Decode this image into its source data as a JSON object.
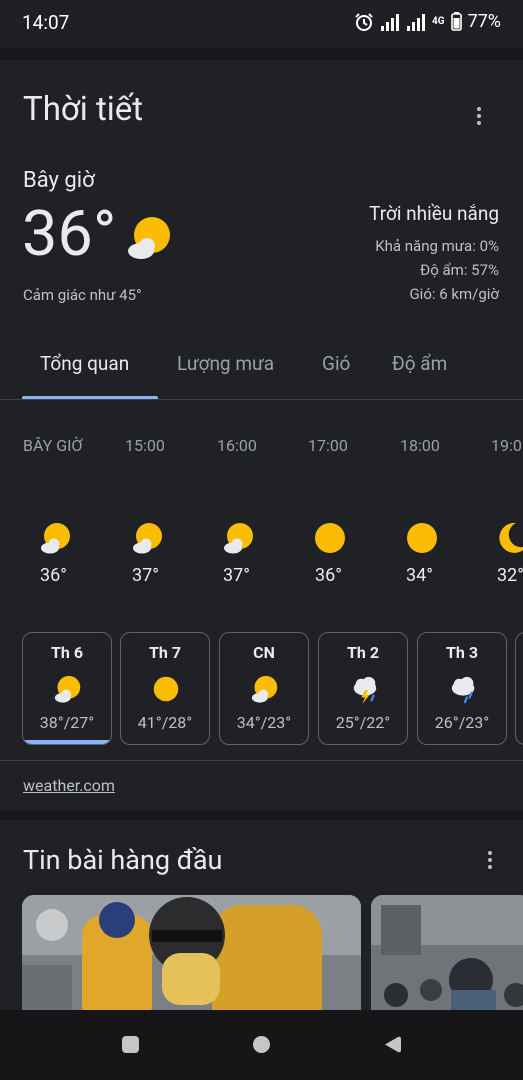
{
  "status_bar": {
    "time": "14:07",
    "battery_percent": "77%",
    "network": "4G",
    "icons": [
      "alarm-icon",
      "signal-icon",
      "signal-icon",
      "network-4g-icon",
      "battery-icon"
    ]
  },
  "weather": {
    "title": "Thời tiết",
    "now_label": "Bây giờ",
    "temperature": "36°",
    "feels_like": "Cảm giác như 45°",
    "condition": "Trời nhiều nắng",
    "details": [
      "Khả năng mưa: 0%",
      "Độ ẩm: 57%",
      "Gió: 6 km/giờ"
    ],
    "tabs": [
      {
        "label": "Tổng quan",
        "active": true
      },
      {
        "label": "Lượng mưa",
        "active": false
      },
      {
        "label": "Gió",
        "active": false
      },
      {
        "label": "Độ ẩm",
        "active": false
      }
    ],
    "hourly": [
      {
        "time": "BÂY GIỜ",
        "temp": "36°",
        "icon": "partly-sunny-icon"
      },
      {
        "time": "15:00",
        "temp": "37°",
        "icon": "partly-sunny-icon"
      },
      {
        "time": "16:00",
        "temp": "37°",
        "icon": "partly-sunny-icon"
      },
      {
        "time": "17:00",
        "temp": "36°",
        "icon": "sunny-icon"
      },
      {
        "time": "18:00",
        "temp": "34°",
        "icon": "sunny-icon"
      },
      {
        "time": "19:0",
        "temp": "32°",
        "icon": "moon-icon"
      }
    ],
    "daily": [
      {
        "day": "Th 6",
        "range": "38°/27°",
        "icon": "partly-sunny-icon",
        "selected": true
      },
      {
        "day": "Th 7",
        "range": "41°/28°",
        "icon": "sunny-icon",
        "selected": false
      },
      {
        "day": "CN",
        "range": "34°/23°",
        "icon": "partly-sunny-icon",
        "selected": false
      },
      {
        "day": "Th 2",
        "range": "25°/22°",
        "icon": "thunderstorm-icon",
        "selected": false
      },
      {
        "day": "Th 3",
        "range": "26°/23°",
        "icon": "rain-icon",
        "selected": false
      }
    ],
    "source": "weather.com"
  },
  "news": {
    "title": "Tin bài hàng đầu"
  },
  "colors": {
    "background": "#1f2023",
    "card": "#202124",
    "accent": "#8ab4f8",
    "sun": "#fbbc04"
  }
}
